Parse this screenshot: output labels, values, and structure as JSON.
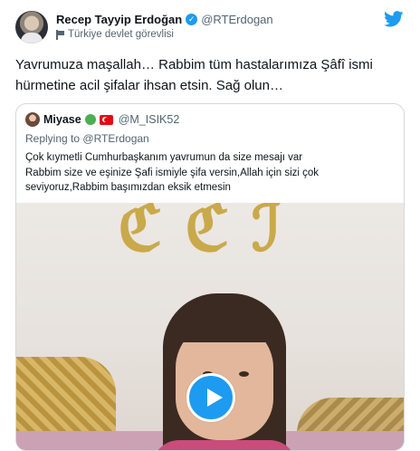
{
  "author": {
    "name": "Recep Tayyip Erdoğan",
    "handle": "@RTErdogan",
    "label": "Türkiye devlet görevlisi"
  },
  "tweet": {
    "text_line1": "Yavrumuza maşallah… Rabbim tüm hastalarımıza Şâfî ismi",
    "text_line2": "hürmetine acil şifalar ihsan etsin. Sağ olun…"
  },
  "quoted": {
    "name": "Miyase",
    "handle": "@M_ISIK52",
    "reply_prefix": "Replying to",
    "reply_to": "@RTErdogan",
    "text_line1": "Çok kıymetli Cumhurbaşkanım yavrumun da size mesajı var",
    "text_line2": "Rabbim size ve eşinize Şafi ismiyle şifa versin,Allah için sizi çok",
    "text_line3": "seviyoruz,Rabbim başımızdan eksik etmesin"
  },
  "icons": {
    "verified": "verified-badge-icon",
    "label": "flag-icon",
    "brand": "twitter-bird-icon",
    "play": "play-icon"
  },
  "colors": {
    "accent": "#1d9bf0",
    "text": "#0f1419",
    "muted": "#536471",
    "border": "#cfd9de"
  }
}
